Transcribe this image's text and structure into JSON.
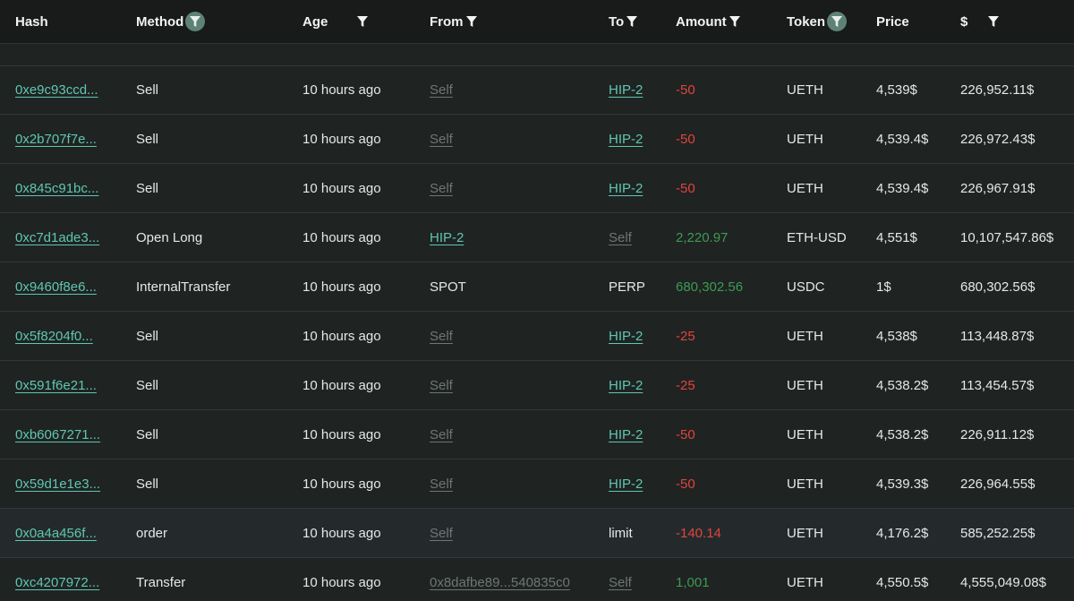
{
  "columns": [
    {
      "key": "hash",
      "label": "Hash",
      "filter": "none"
    },
    {
      "key": "method",
      "label": "Method",
      "filter": "active"
    },
    {
      "key": "age",
      "label": "Age",
      "filter": "plain"
    },
    {
      "key": "from",
      "label": "From",
      "filter": "plain"
    },
    {
      "key": "to",
      "label": "To",
      "filter": "plain"
    },
    {
      "key": "amount",
      "label": "Amount",
      "filter": "plain"
    },
    {
      "key": "token",
      "label": "Token",
      "filter": "active"
    },
    {
      "key": "price",
      "label": "Price",
      "filter": "none"
    },
    {
      "key": "usd",
      "label": "$",
      "filter": "plain"
    }
  ],
  "colors": {
    "teal_link": "#5fc7b0",
    "muted_link": "#6f7675",
    "negative": "#e0443d",
    "positive": "#3e9a52",
    "filter_active_bg": "#5f8277"
  },
  "rows": [
    {
      "hash": "0xe9c93ccd...",
      "method": "Sell",
      "age": "10 hours ago",
      "from": "Self",
      "from_style": "muted-link",
      "to": "HIP-2",
      "to_style": "teal-link",
      "amount": "-50",
      "amount_sign": "neg",
      "token": "UETH",
      "price": "4,539$",
      "usd": "226,952.11$",
      "highlight": false
    },
    {
      "hash": "0x2b707f7e...",
      "method": "Sell",
      "age": "10 hours ago",
      "from": "Self",
      "from_style": "muted-link",
      "to": "HIP-2",
      "to_style": "teal-link",
      "amount": "-50",
      "amount_sign": "neg",
      "token": "UETH",
      "price": "4,539.4$",
      "usd": "226,972.43$",
      "highlight": false
    },
    {
      "hash": "0x845c91bc...",
      "method": "Sell",
      "age": "10 hours ago",
      "from": "Self",
      "from_style": "muted-link",
      "to": "HIP-2",
      "to_style": "teal-link",
      "amount": "-50",
      "amount_sign": "neg",
      "token": "UETH",
      "price": "4,539.4$",
      "usd": "226,967.91$",
      "highlight": false
    },
    {
      "hash": "0xc7d1ade3...",
      "method": "Open Long",
      "age": "10 hours ago",
      "from": "HIP-2",
      "from_style": "teal-link",
      "to": "Self",
      "to_style": "muted-link",
      "amount": "2,220.97",
      "amount_sign": "pos",
      "token": "ETH-USD",
      "price": "4,551$",
      "usd": "10,107,547.86$",
      "highlight": false
    },
    {
      "hash": "0x9460f8e6...",
      "method": "InternalTransfer",
      "age": "10 hours ago",
      "from": "SPOT",
      "from_style": "plain",
      "to": "PERP",
      "to_style": "plain",
      "amount": "680,302.56",
      "amount_sign": "pos",
      "token": "USDC",
      "price": "1$",
      "usd": "680,302.56$",
      "highlight": false
    },
    {
      "hash": "0x5f8204f0...",
      "method": "Sell",
      "age": "10 hours ago",
      "from": "Self",
      "from_style": "muted-link",
      "to": "HIP-2",
      "to_style": "teal-link",
      "amount": "-25",
      "amount_sign": "neg",
      "token": "UETH",
      "price": "4,538$",
      "usd": "113,448.87$",
      "highlight": false
    },
    {
      "hash": "0x591f6e21...",
      "method": "Sell",
      "age": "10 hours ago",
      "from": "Self",
      "from_style": "muted-link",
      "to": "HIP-2",
      "to_style": "teal-link",
      "amount": "-25",
      "amount_sign": "neg",
      "token": "UETH",
      "price": "4,538.2$",
      "usd": "113,454.57$",
      "highlight": false
    },
    {
      "hash": "0xb6067271...",
      "method": "Sell",
      "age": "10 hours ago",
      "from": "Self",
      "from_style": "muted-link",
      "to": "HIP-2",
      "to_style": "teal-link",
      "amount": "-50",
      "amount_sign": "neg",
      "token": "UETH",
      "price": "4,538.2$",
      "usd": "226,911.12$",
      "highlight": false
    },
    {
      "hash": "0x59d1e1e3...",
      "method": "Sell",
      "age": "10 hours ago",
      "from": "Self",
      "from_style": "muted-link",
      "to": "HIP-2",
      "to_style": "teal-link",
      "amount": "-50",
      "amount_sign": "neg",
      "token": "UETH",
      "price": "4,539.3$",
      "usd": "226,964.55$",
      "highlight": false
    },
    {
      "hash": "0x0a4a456f...",
      "method": "order",
      "age": "10 hours ago",
      "from": "Self",
      "from_style": "muted-link",
      "to": "limit",
      "to_style": "plain",
      "amount": "-140.14",
      "amount_sign": "neg",
      "token": "UETH",
      "price": "4,176.2$",
      "usd": "585,252.25$",
      "highlight": true
    },
    {
      "hash": "0xc4207972...",
      "method": "Transfer",
      "age": "10 hours ago",
      "from": "0x8dafbe89...540835c0",
      "from_style": "muted-link",
      "to": "Self",
      "to_style": "muted-link",
      "amount": "1,001",
      "amount_sign": "pos",
      "token": "UETH",
      "price": "4,550.5$",
      "usd": "4,555,049.08$",
      "highlight": false
    }
  ]
}
